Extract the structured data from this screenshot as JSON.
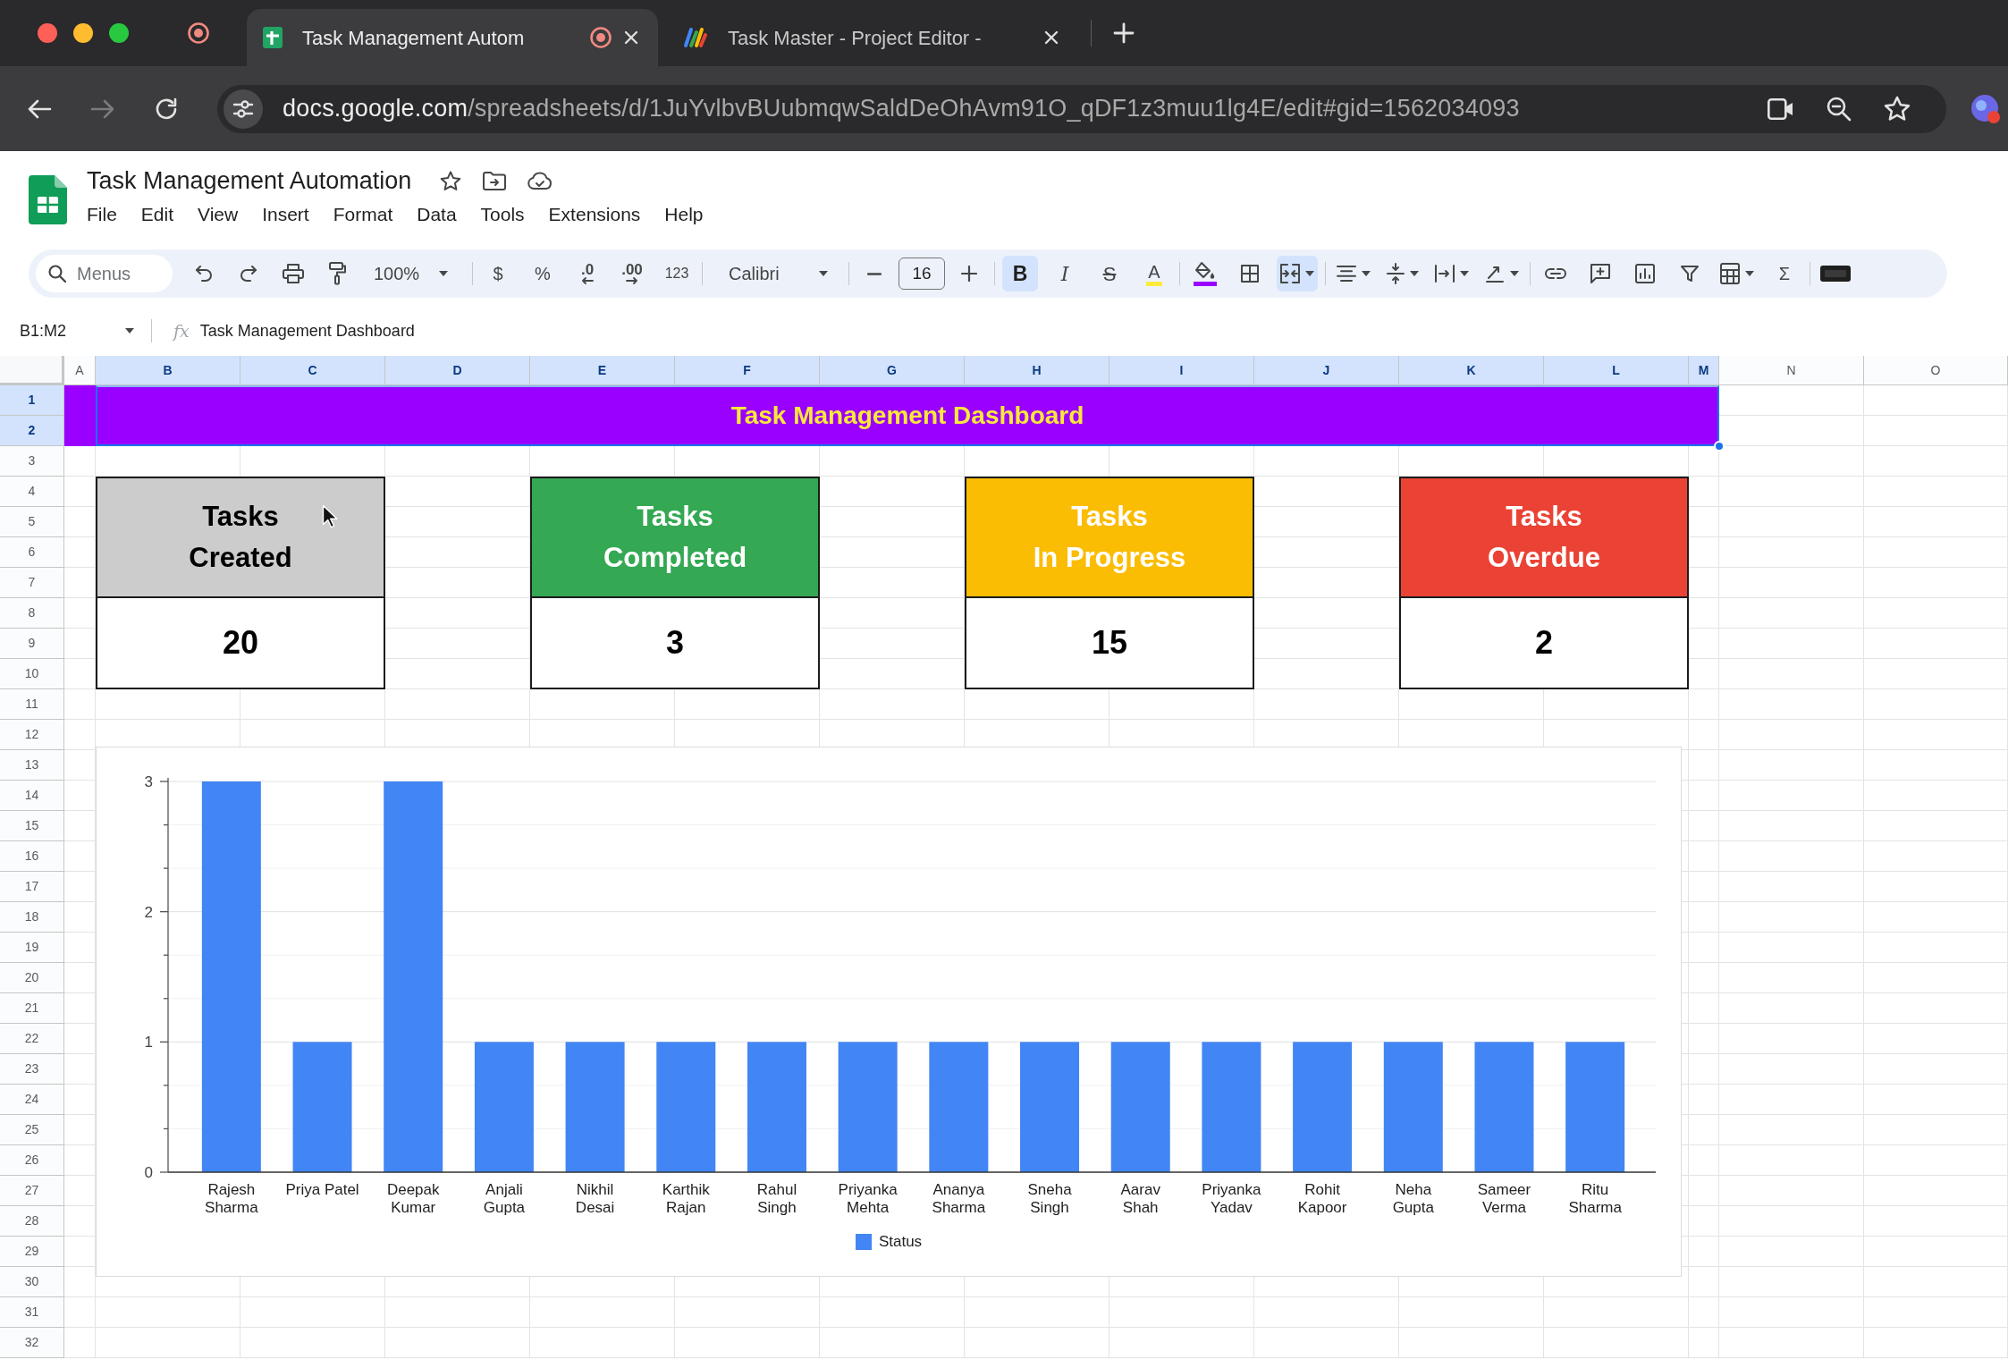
{
  "browser": {
    "tabs": [
      {
        "kind": "spreadsheet",
        "title": "Task Management Autom",
        "selected": true,
        "recording": true
      },
      {
        "kind": "app",
        "title": "Task Master - Project Editor -",
        "selected": false,
        "recording": false
      }
    ],
    "forward_disabled": true,
    "address": {
      "host": "docs.google.com",
      "path": "/spreadsheets/d/1JuYvlbvBUubmqwSaldDeOhAvm91O_qDF1z3muu1lg4E/edit#gid=1562034093"
    }
  },
  "document": {
    "title": "Task Management Automation",
    "menus": [
      "File",
      "Edit",
      "View",
      "Insert",
      "Format",
      "Data",
      "Tools",
      "Extensions",
      "Help"
    ]
  },
  "toolbar": {
    "search": {
      "placeholder": "Menus"
    },
    "zoom": "100%",
    "currency": "$",
    "percent": "%",
    "decimal_decrease": ".0",
    "decimal_increase": ".00",
    "number_formats": "123",
    "font": "Calibri",
    "font_size": "16",
    "text_styles": [
      {
        "kind": "bold",
        "glyph": "B",
        "active": true
      },
      {
        "kind": "italic",
        "glyph": "I",
        "active": false
      },
      {
        "kind": "strikethrough",
        "glyph": "S",
        "active": false
      },
      {
        "kind": "text_color",
        "glyph": "A",
        "active": false
      }
    ],
    "merge_active": true,
    "functions": "Σ"
  },
  "formula_bar": {
    "name_box": "B1:M2",
    "fx_label": "fx",
    "content": "Task Management Dashboard"
  },
  "sheet": {
    "columns": [
      {
        "label": "A",
        "selected": false
      },
      {
        "label": "B",
        "selected": true
      },
      {
        "label": "C",
        "selected": true
      },
      {
        "label": "D",
        "selected": true
      },
      {
        "label": "E",
        "selected": true
      },
      {
        "label": "F",
        "selected": true
      },
      {
        "label": "G",
        "selected": true
      },
      {
        "label": "H",
        "selected": true
      },
      {
        "label": "I",
        "selected": true
      },
      {
        "label": "J",
        "selected": true
      },
      {
        "label": "K",
        "selected": true
      },
      {
        "label": "L",
        "selected": true
      },
      {
        "label": "M",
        "selected": true
      },
      {
        "label": "N",
        "selected": false
      },
      {
        "label": "O",
        "selected": false
      }
    ],
    "rows": [
      {
        "label": "1",
        "selected": true
      },
      {
        "label": "2",
        "selected": true
      },
      {
        "label": "3",
        "selected": false
      },
      {
        "label": "4",
        "selected": false
      },
      {
        "label": "5",
        "selected": false
      },
      {
        "label": "6",
        "selected": false
      },
      {
        "label": "7",
        "selected": false
      },
      {
        "label": "8",
        "selected": false
      },
      {
        "label": "9",
        "selected": false
      },
      {
        "label": "10",
        "selected": false
      },
      {
        "label": "11",
        "selected": false
      },
      {
        "label": "12",
        "selected": false
      },
      {
        "label": "13",
        "selected": false
      },
      {
        "label": "14",
        "selected": false
      },
      {
        "label": "15",
        "selected": false
      },
      {
        "label": "16",
        "selected": false
      },
      {
        "label": "17",
        "selected": false
      },
      {
        "label": "18",
        "selected": false
      },
      {
        "label": "19",
        "selected": false
      },
      {
        "label": "20",
        "selected": false
      },
      {
        "label": "21",
        "selected": false
      },
      {
        "label": "22",
        "selected": false
      },
      {
        "label": "23",
        "selected": false
      },
      {
        "label": "24",
        "selected": false
      },
      {
        "label": "25",
        "selected": false
      },
      {
        "label": "26",
        "selected": false
      },
      {
        "label": "27",
        "selected": false
      },
      {
        "label": "28",
        "selected": false
      },
      {
        "label": "29",
        "selected": false
      },
      {
        "label": "30",
        "selected": false
      },
      {
        "label": "31",
        "selected": false
      },
      {
        "label": "32",
        "selected": false
      }
    ],
    "title_banner": {
      "text": "Task Management Dashboard",
      "selected": true
    },
    "cards": [
      {
        "title": {
          "text": "Tasks\nCreated",
          "color": "#000000"
        },
        "value": "20",
        "color": "#cccccc"
      },
      {
        "title": {
          "text": "Tasks\nCompleted",
          "color": "#ffffff"
        },
        "value": "3",
        "color": "#34a853"
      },
      {
        "title": {
          "text": "Tasks\nIn Progress",
          "color": "#ffffff"
        },
        "value": "15",
        "color": "#fbbc04"
      },
      {
        "title": {
          "text": "Tasks\nOverdue",
          "color": "#ffffff"
        },
        "value": "2",
        "color": "#ea4335"
      }
    ],
    "chart": {
      "chart_data": {
        "type": "bar",
        "categories": [
          "Rajesh Sharma",
          "Priya Patel",
          "Deepak Kumar",
          "Anjali Gupta",
          "Nikhil Desai",
          "Karthik Rajan",
          "Rahul Singh",
          "Priyanka Mehta",
          "Ananya Sharma",
          "Sneha Singh",
          "Aarav Shah",
          "Priyanka Yadav",
          "Rohit Kapoor",
          "Neha Gupta",
          "Sameer Verma",
          "Ritu Sharma"
        ],
        "series": [
          {
            "name": "Status",
            "color": "#4285f4",
            "values": [
              3,
              1,
              3,
              1,
              1,
              1,
              1,
              1,
              1,
              1,
              1,
              1,
              1,
              1,
              1,
              1
            ]
          }
        ],
        "ylim": [
          0,
          3
        ],
        "yticks": [
          0,
          1,
          2,
          3
        ]
      }
    }
  }
}
